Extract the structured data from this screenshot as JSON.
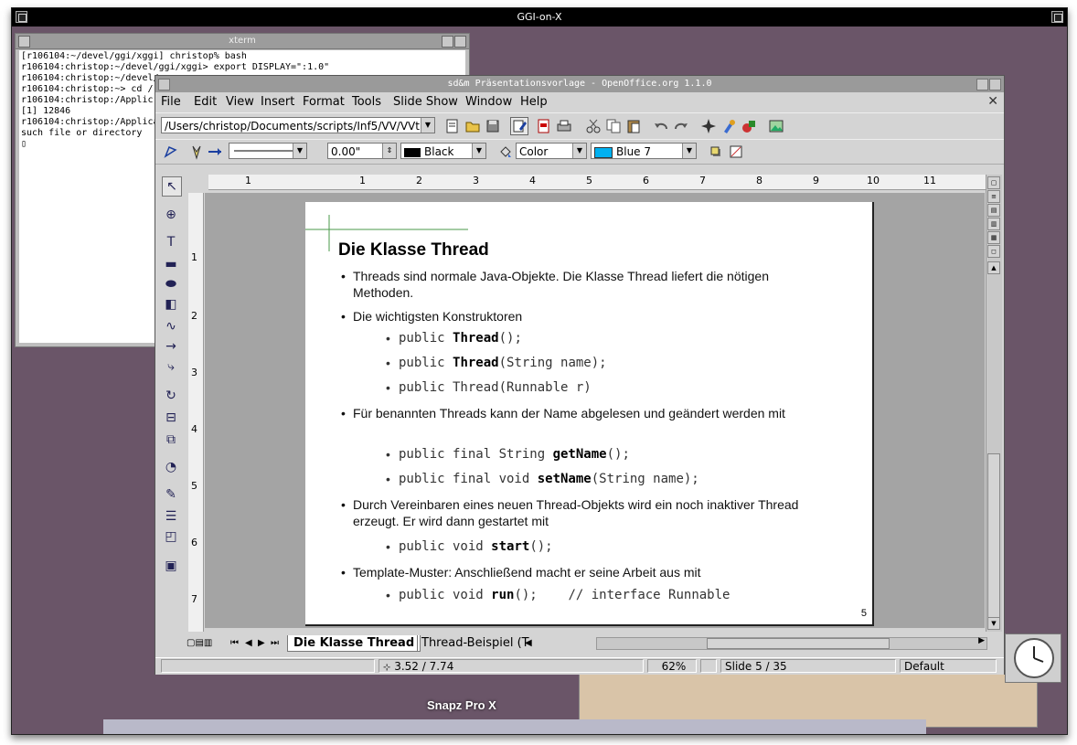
{
  "outer_window": {
    "title": "GGI-on-X"
  },
  "xterm": {
    "title": "xterm",
    "lines": [
      "[r106104:~/devel/ggi/xggi] christop% bash",
      "r106104:christop:~/devel/ggi/xggi> export DISPLAY=\":1.0\"",
      "r106104:christop:~/devel/",
      "r106104:christop:~> cd /",
      "r106104:christop:/Applic",
      "[1] 12846",
      "r106104:christop:/Applica",
      "such file or directory",
      "▯"
    ]
  },
  "office": {
    "title": "sd&m Präsentationsvorlage - OpenOffice.org 1.1.0",
    "menu": [
      "File",
      "Edit",
      "View",
      "Insert",
      "Format",
      "Tools",
      "Slide Show",
      "Window",
      "Help"
    ],
    "path_value": "/Users/christop/Documents/scripts/Inf5/VV/VVt",
    "line_width": "0.00\"",
    "line_color": "Black",
    "area_style": "Color",
    "area_color": "Blue 7",
    "colors": {
      "black_swatch": "#000000",
      "blue7_swatch": "#00b0f0"
    }
  },
  "ruler": {
    "h_numbers": [
      "1",
      "1",
      "2",
      "3",
      "4",
      "5",
      "6",
      "7",
      "8",
      "9",
      "10",
      "11"
    ],
    "v_numbers": [
      "1",
      "2",
      "3",
      "4",
      "5",
      "6",
      "7"
    ]
  },
  "slide": {
    "title": "Die Klasse Thread",
    "b1": "Threads sind normale Java-Objekte. Die Klasse Thread liefert die nötigen Methoden.",
    "b2": "Die wichtigsten Konstruktoren",
    "c1_pre": "public ",
    "c1_bold": "Thread",
    "c1_post": "();",
    "c2_pre": "public ",
    "c2_bold": "Thread",
    "c2_post": "(String name);",
    "c3": "public Thread(Runnable r)",
    "b3": "Für benannten Threads kann der Name abgelesen und geändert werden mit",
    "c4_pre": "public final String ",
    "c4_bold": "getName",
    "c4_post": "();",
    "c5_pre": "public final void ",
    "c5_bold": "setName",
    "c5_post": "(String name);",
    "b4": "Durch Vereinbaren eines neuen Thread-Objekts wird ein noch inaktiver Thread erzeugt. Er wird dann gestartet mit",
    "c6_pre": "public void ",
    "c6_bold": "start",
    "c6_post": "();",
    "b5": "Template-Muster: Anschließend macht er seine Arbeit aus mit",
    "c7_pre": "public void ",
    "c7_bold": "run",
    "c7_post": "();    // interface Runnable",
    "page_number": "5"
  },
  "tabs": {
    "active": "Die Klasse Thread",
    "next": "Thread-Beispiel (T"
  },
  "status": {
    "position": "3.52 / 7.74",
    "zoom": "62%",
    "slide": "Slide 5 / 35",
    "layout": "Default"
  },
  "desktop": {
    "snapz_label": "Snapz Pro X"
  }
}
